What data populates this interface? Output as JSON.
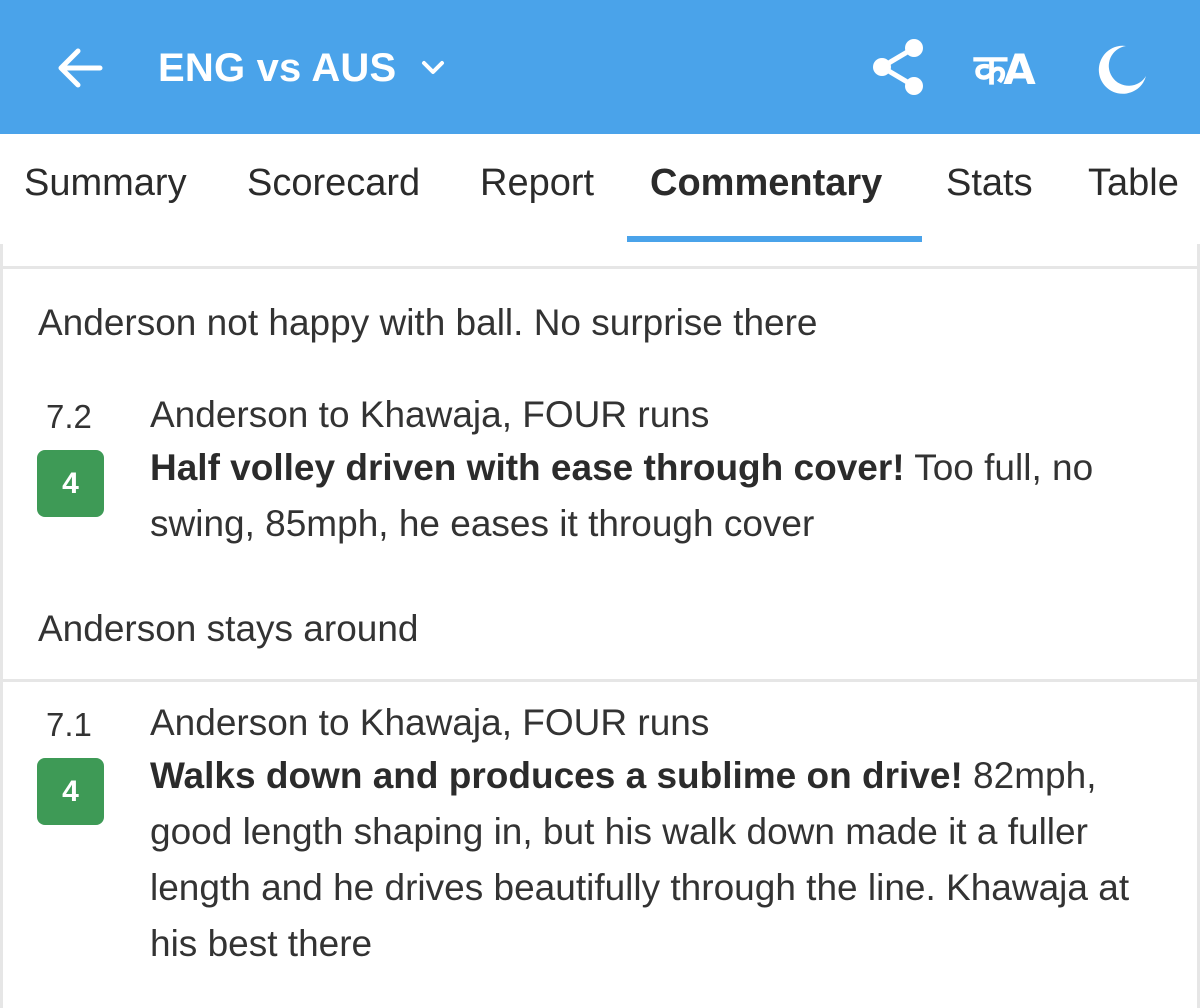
{
  "header": {
    "title": "ENG vs AUS",
    "lang_toggle": "कA",
    "icons": [
      "back-arrow-icon",
      "chevron-down-icon",
      "share-icon",
      "language-icon",
      "moon-icon"
    ],
    "bg_color": "#4aa3ea"
  },
  "tabs": [
    {
      "label": "Summary"
    },
    {
      "label": "Scorecard"
    },
    {
      "label": "Report"
    },
    {
      "label": "Commentary",
      "active": true
    },
    {
      "label": "Stats"
    },
    {
      "label": "Table"
    }
  ],
  "commentary": {
    "notes": [
      "Anderson not happy with ball. No surprise there",
      "Anderson stays around"
    ],
    "balls": [
      {
        "over": "7.2",
        "runs": "4",
        "headline": "Anderson to Khawaja, FOUR runs",
        "bold": "Half volley driven with ease through cover!",
        "text": " Too full, no swing, 85mph, he eases it through cover"
      },
      {
        "over": "7.1",
        "runs": "4",
        "headline": "Anderson to Khawaja, FOUR runs",
        "bold": "Walks down and produces a sublime on drive!",
        "text": " 82mph, good length shaping in, but his walk down made it a fuller length and he drives beautifully through the line. Khawaja at his best there"
      }
    ],
    "badge_color": "#3e9a56"
  }
}
